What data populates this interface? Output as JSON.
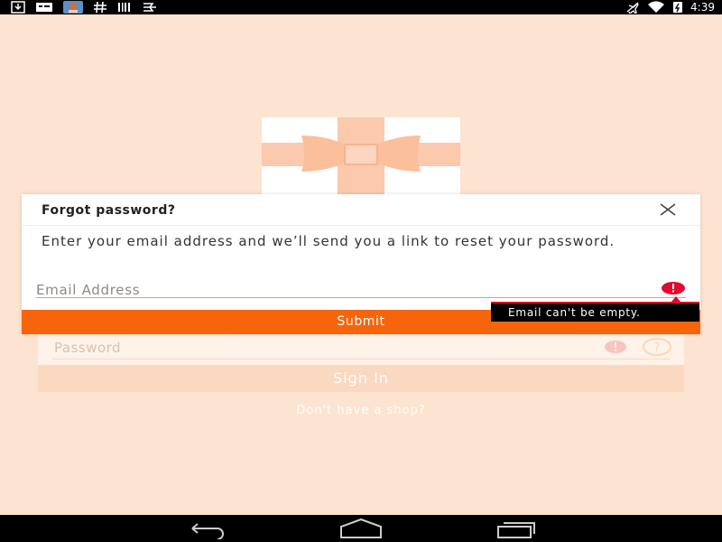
{
  "status_bar": {
    "time": "4:39",
    "left_icons": [
      "download-icon",
      "message-icon",
      "photo-notification-icon",
      "hash-icon",
      "barcode-icon",
      "check-flag-icon"
    ],
    "right_icons": [
      "airplane-muted-icon",
      "wifi-icon",
      "battery-charging-icon"
    ]
  },
  "background": {
    "password_placeholder": "Password",
    "sign_in_label": "Sign In",
    "no_shop_link": "Don't have a shop?"
  },
  "dialog": {
    "title": "Forgot password?",
    "message": "Enter your email address and we’ll send you a link to reset your password.",
    "email_placeholder": "Email Address",
    "email_value": "",
    "error_text": "Email can't be empty.",
    "submit_label": "Submit"
  },
  "nav_bar": {
    "buttons": [
      "back-icon",
      "home-icon",
      "recents-icon"
    ]
  },
  "colors": {
    "accent": "#f6650c",
    "error": "#e0092f",
    "background": "#fde4d0"
  }
}
